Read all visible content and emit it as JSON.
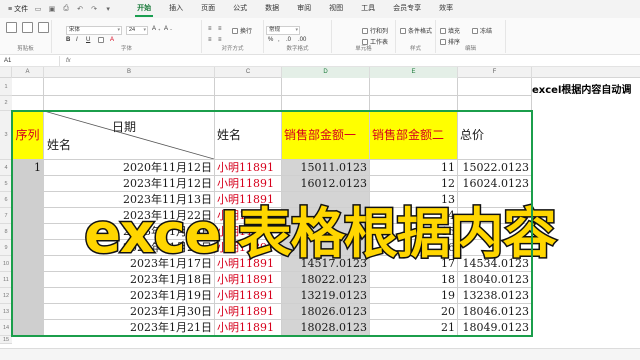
{
  "titlebar": {
    "file_label": "文件",
    "menu": [
      "开始",
      "插入",
      "页面",
      "公式",
      "数据",
      "审阅",
      "视图",
      "工具",
      "会员专享",
      "效率"
    ],
    "active_menu": "开始"
  },
  "ribbon": {
    "groups": {
      "clipboard": "剪贴板",
      "font": "字体",
      "alignment": "对齐方式",
      "number": "数字格式",
      "cells": "单元格",
      "style": "样式",
      "editing": "编辑"
    },
    "font_name": "宋体",
    "font_size": "24",
    "number_format": "常规",
    "buttons": {
      "wrap": "换行",
      "row_col": "行和列",
      "worksheet": "工作表",
      "cond_format": "条件格式",
      "fill": "填充",
      "sort": "排序",
      "freeze": "冻结"
    }
  },
  "formula_bar": {
    "name_box": "A1",
    "fx": "fx"
  },
  "columns": [
    "A",
    "B",
    "C",
    "D",
    "E",
    "F"
  ],
  "rows": [
    "1",
    "2",
    "3",
    "4",
    "5",
    "6",
    "7",
    "8",
    "9",
    "10",
    "11",
    "12",
    "13",
    "14",
    "15"
  ],
  "table": {
    "header": {
      "seq": "序列",
      "date": "日期",
      "name_diag": "姓名",
      "name": "姓名",
      "sales1": "销售部金额一",
      "sales2": "销售部金额二",
      "total": "总价"
    },
    "rows": [
      {
        "seq": "1",
        "date": "2020年11月12日",
        "name": "小明11891",
        "a": "15011.0123",
        "b": "11",
        "total": "15022.0123"
      },
      {
        "seq": "",
        "date": "2023年11月12日",
        "name": "小明11891",
        "a": "16012.0123",
        "b": "12",
        "total": "16024.0123"
      },
      {
        "seq": "",
        "date": "2023年11月13日",
        "name": "小明11891",
        "a": "",
        "b": "13",
        "total": ""
      },
      {
        "seq": "",
        "date": "2023年11月22日",
        "name": "小明11891",
        "a": "",
        "b": "14",
        "total": ""
      },
      {
        "seq": "",
        "date": "2023年11月23日",
        "name": "小明11891",
        "a": "",
        "b": "15",
        "total": ""
      },
      {
        "seq": "",
        "date": "2023年11月25日",
        "name": "小明11891",
        "a": "",
        "b": "16",
        "total": ""
      },
      {
        "seq": "",
        "date": "2023年1月17日",
        "name": "小明11891",
        "a": "14517.0123",
        "b": "17",
        "total": "14534.0123"
      },
      {
        "seq": "",
        "date": "2023年1月18日",
        "name": "小明11891",
        "a": "18022.0123",
        "b": "18",
        "total": "18040.0123"
      },
      {
        "seq": "",
        "date": "2023年1月19日",
        "name": "小明11891",
        "a": "13219.0123",
        "b": "19",
        "total": "13238.0123"
      },
      {
        "seq": "",
        "date": "2023年1月30日",
        "name": "小明11891",
        "a": "18026.0123",
        "b": "20",
        "total": "18046.0123"
      },
      {
        "seq": "",
        "date": "2023年1月21日",
        "name": "小明11891",
        "a": "18028.0123",
        "b": "21",
        "total": "18049.0123"
      }
    ]
  },
  "side_title": "excel根据内容自动调",
  "overlay_text": "excel表格根据内容",
  "colors": {
    "accent_green": "#1b9e4b",
    "header_yellow": "#ffff00",
    "red_text": "#d6001c",
    "overlay_yellow": "#ffd600"
  }
}
